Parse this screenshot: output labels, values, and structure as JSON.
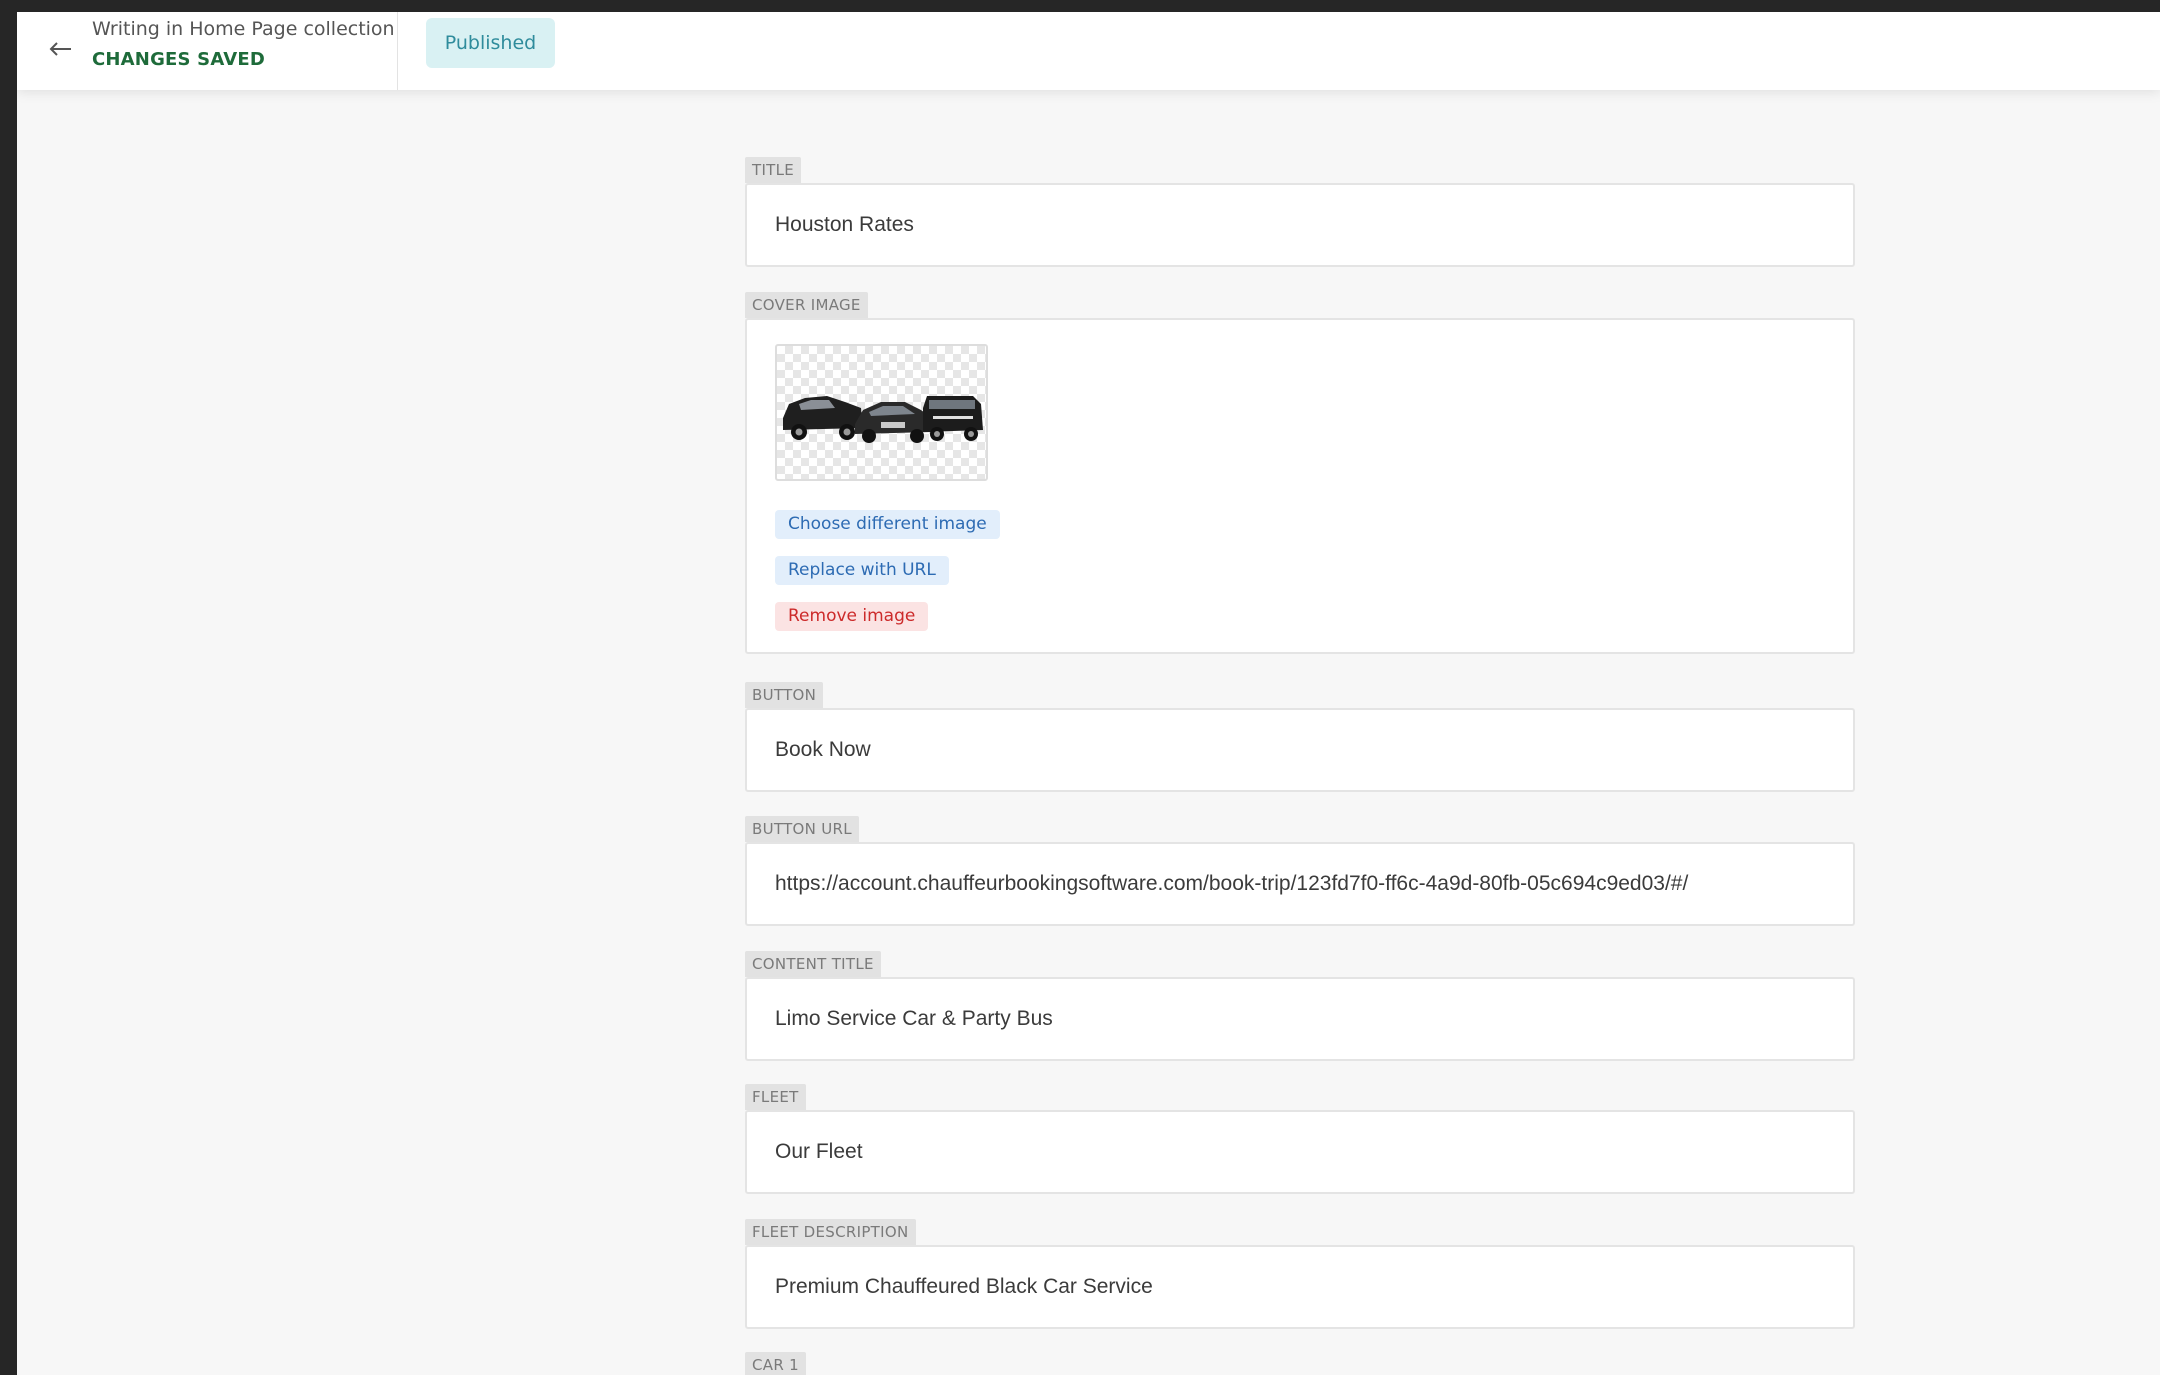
{
  "header": {
    "back_icon": "arrow-left-icon",
    "breadcrumb": "Writing in Home Page collection",
    "save_status": "CHANGES SAVED",
    "status_badge": "Published",
    "colors": {
      "save_status": "#1e6b3a",
      "badge_bg": "#d9f1f3",
      "badge_text": "#2f8c9c"
    }
  },
  "form": {
    "title": {
      "label": "TITLE",
      "value": "Houston Rates"
    },
    "cover_image": {
      "label": "COVER IMAGE",
      "image_icon": "limousine-fleet-thumbnail",
      "choose_label": "Choose different image",
      "replace_label": "Replace with URL",
      "remove_label": "Remove image"
    },
    "button": {
      "label": "BUTTON",
      "value": "Book Now"
    },
    "button_url": {
      "label": "BUTTON URL",
      "value": "https://account.chauffeurbookingsoftware.com/book-trip/123fd7f0-ff6c-4a9d-80fb-05c694c9ed03/#/"
    },
    "content_title": {
      "label": "CONTENT TITLE",
      "value": "Limo Service Car & Party Bus"
    },
    "fleet": {
      "label": "FLEET",
      "value": "Our Fleet"
    },
    "fleet_description": {
      "label": "FLEET DESCRIPTION",
      "value": "Premium Chauffeured Black Car Service"
    },
    "car_1": {
      "label": "CAR 1"
    }
  }
}
